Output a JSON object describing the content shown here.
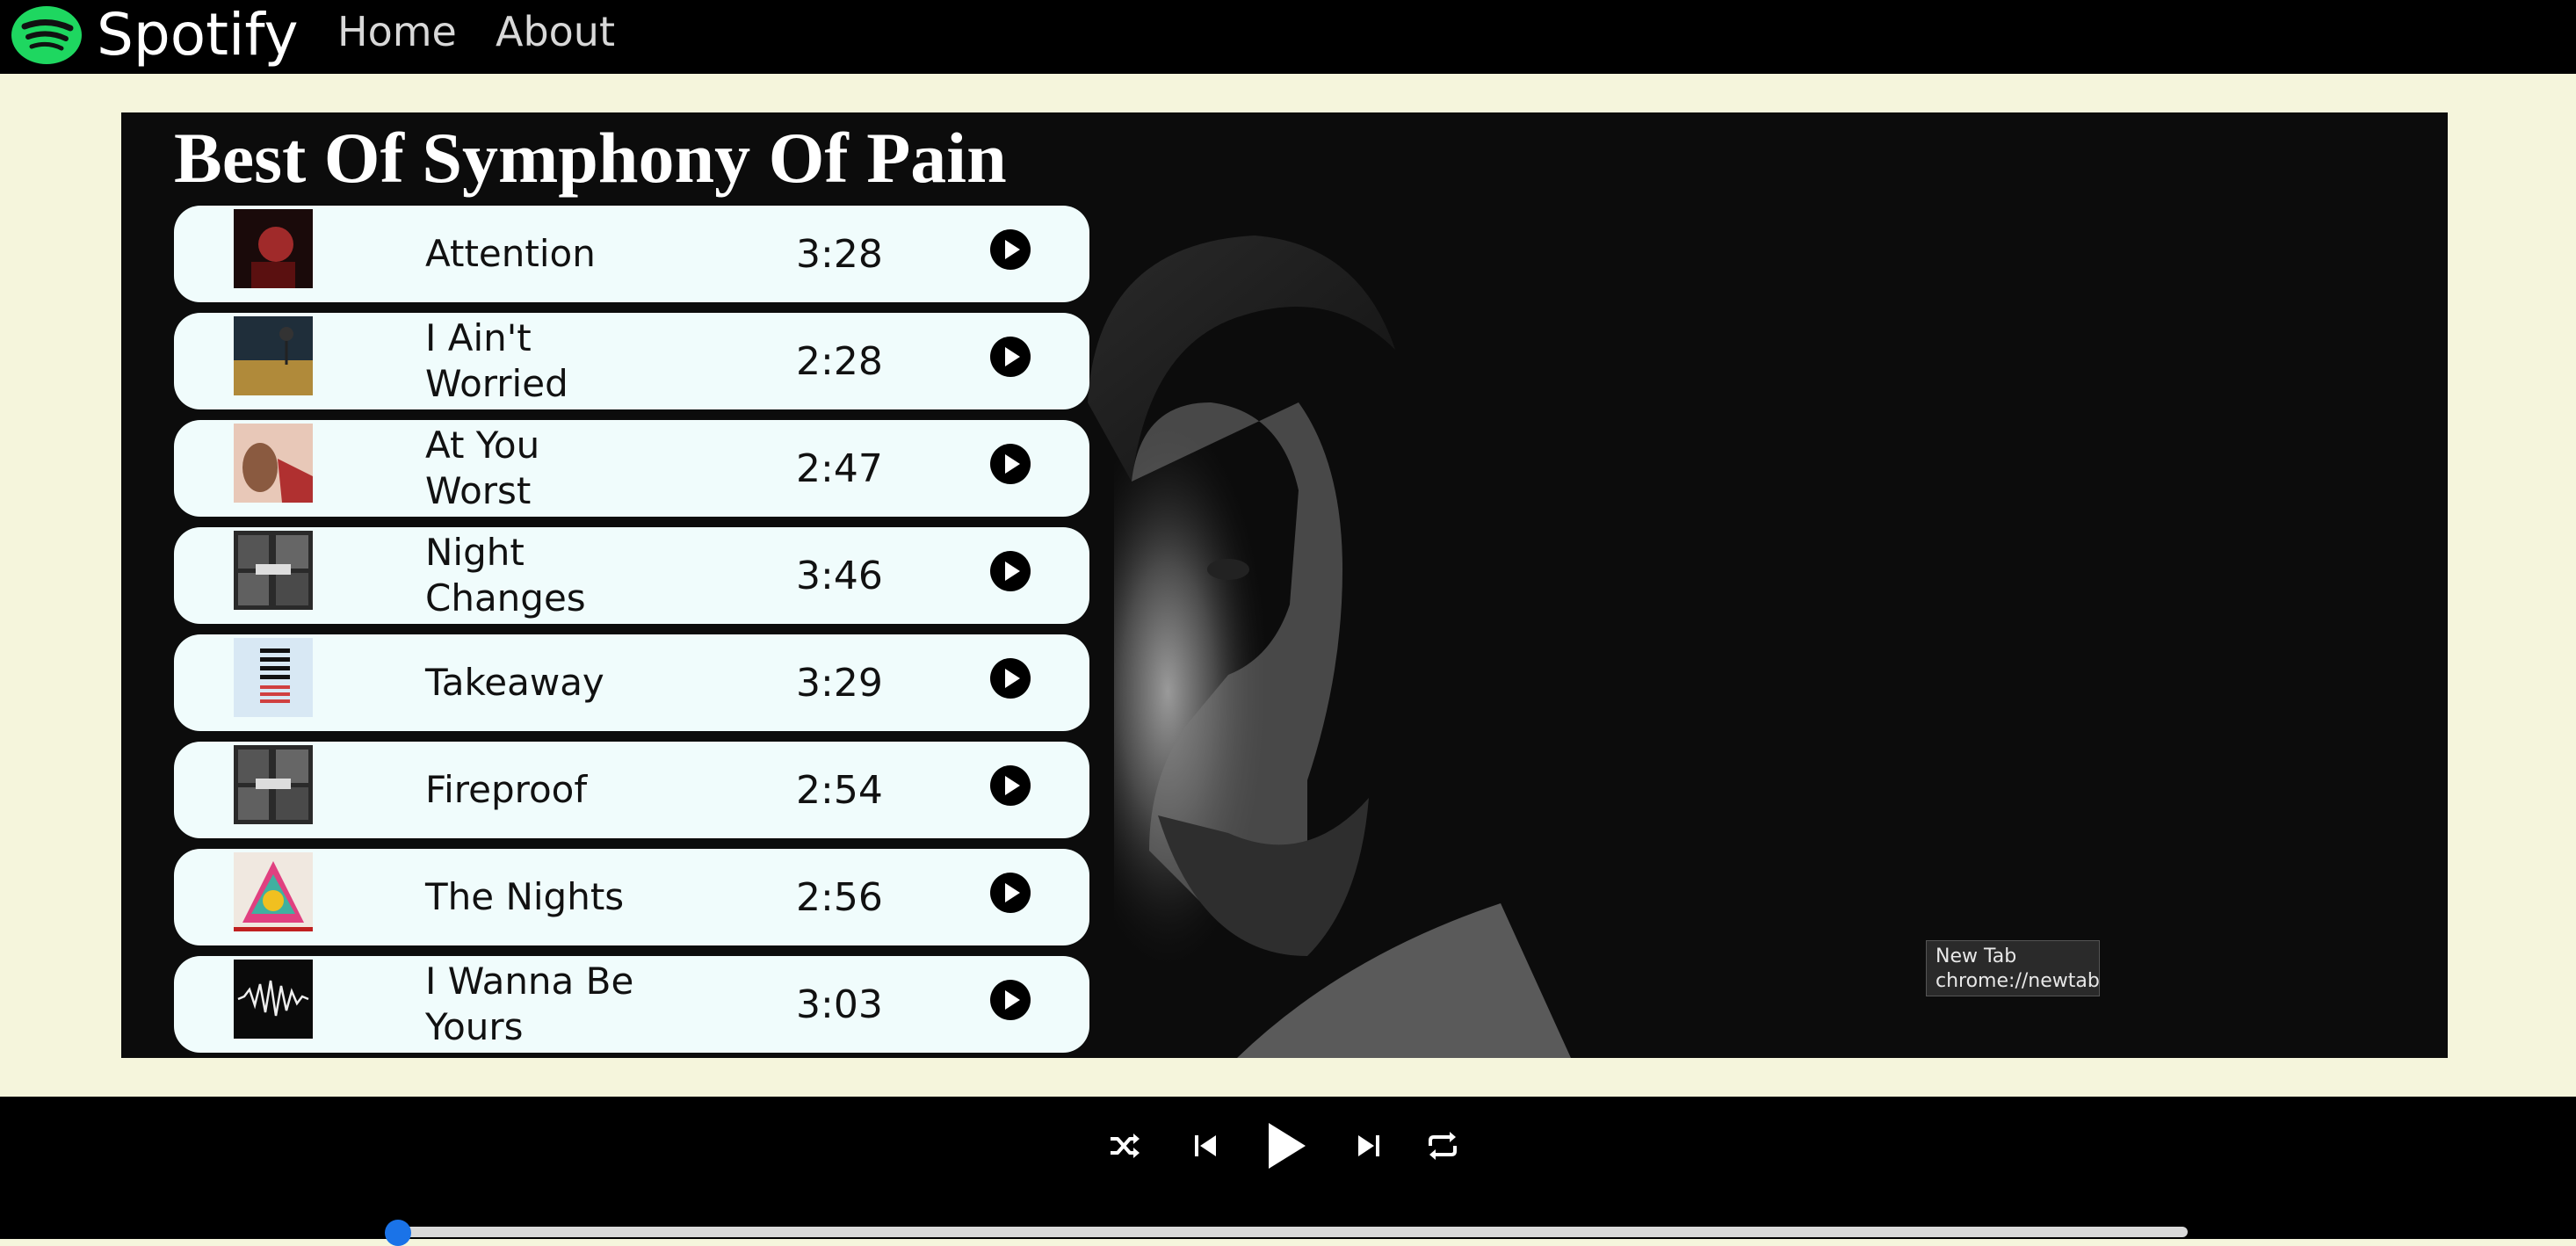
{
  "nav": {
    "brand": "Spotify",
    "logo_icon": "spotify-logo-icon",
    "links": [
      "Home",
      "About"
    ]
  },
  "playlist": {
    "title": "Best Of Symphony Of Pain",
    "songs": [
      {
        "name": "Attention",
        "duration": "3:28"
      },
      {
        "name": "I Ain't Worried",
        "duration": "2:28"
      },
      {
        "name": "At You Worst",
        "duration": "2:47"
      },
      {
        "name": "Night Changes",
        "duration": "3:46"
      },
      {
        "name": "Takeaway",
        "duration": "3:29"
      },
      {
        "name": "Fireproof",
        "duration": "2:54"
      },
      {
        "name": "The Nights",
        "duration": "2:56"
      },
      {
        "name": "I Wanna Be Yours",
        "duration": "3:03"
      }
    ]
  },
  "tooltip": {
    "line1": "New Tab",
    "line2": "chrome://newtab"
  },
  "player": {
    "controls": [
      "shuffle-icon",
      "previous-icon",
      "play-icon",
      "next-icon",
      "repeat-icon"
    ],
    "progress": 0.0
  },
  "colors": {
    "brand_green": "#1ed760",
    "page_bg": "#f5f5dc",
    "song_row_bg": "#f0fcfc",
    "progress_accent": "#1a73e8"
  }
}
